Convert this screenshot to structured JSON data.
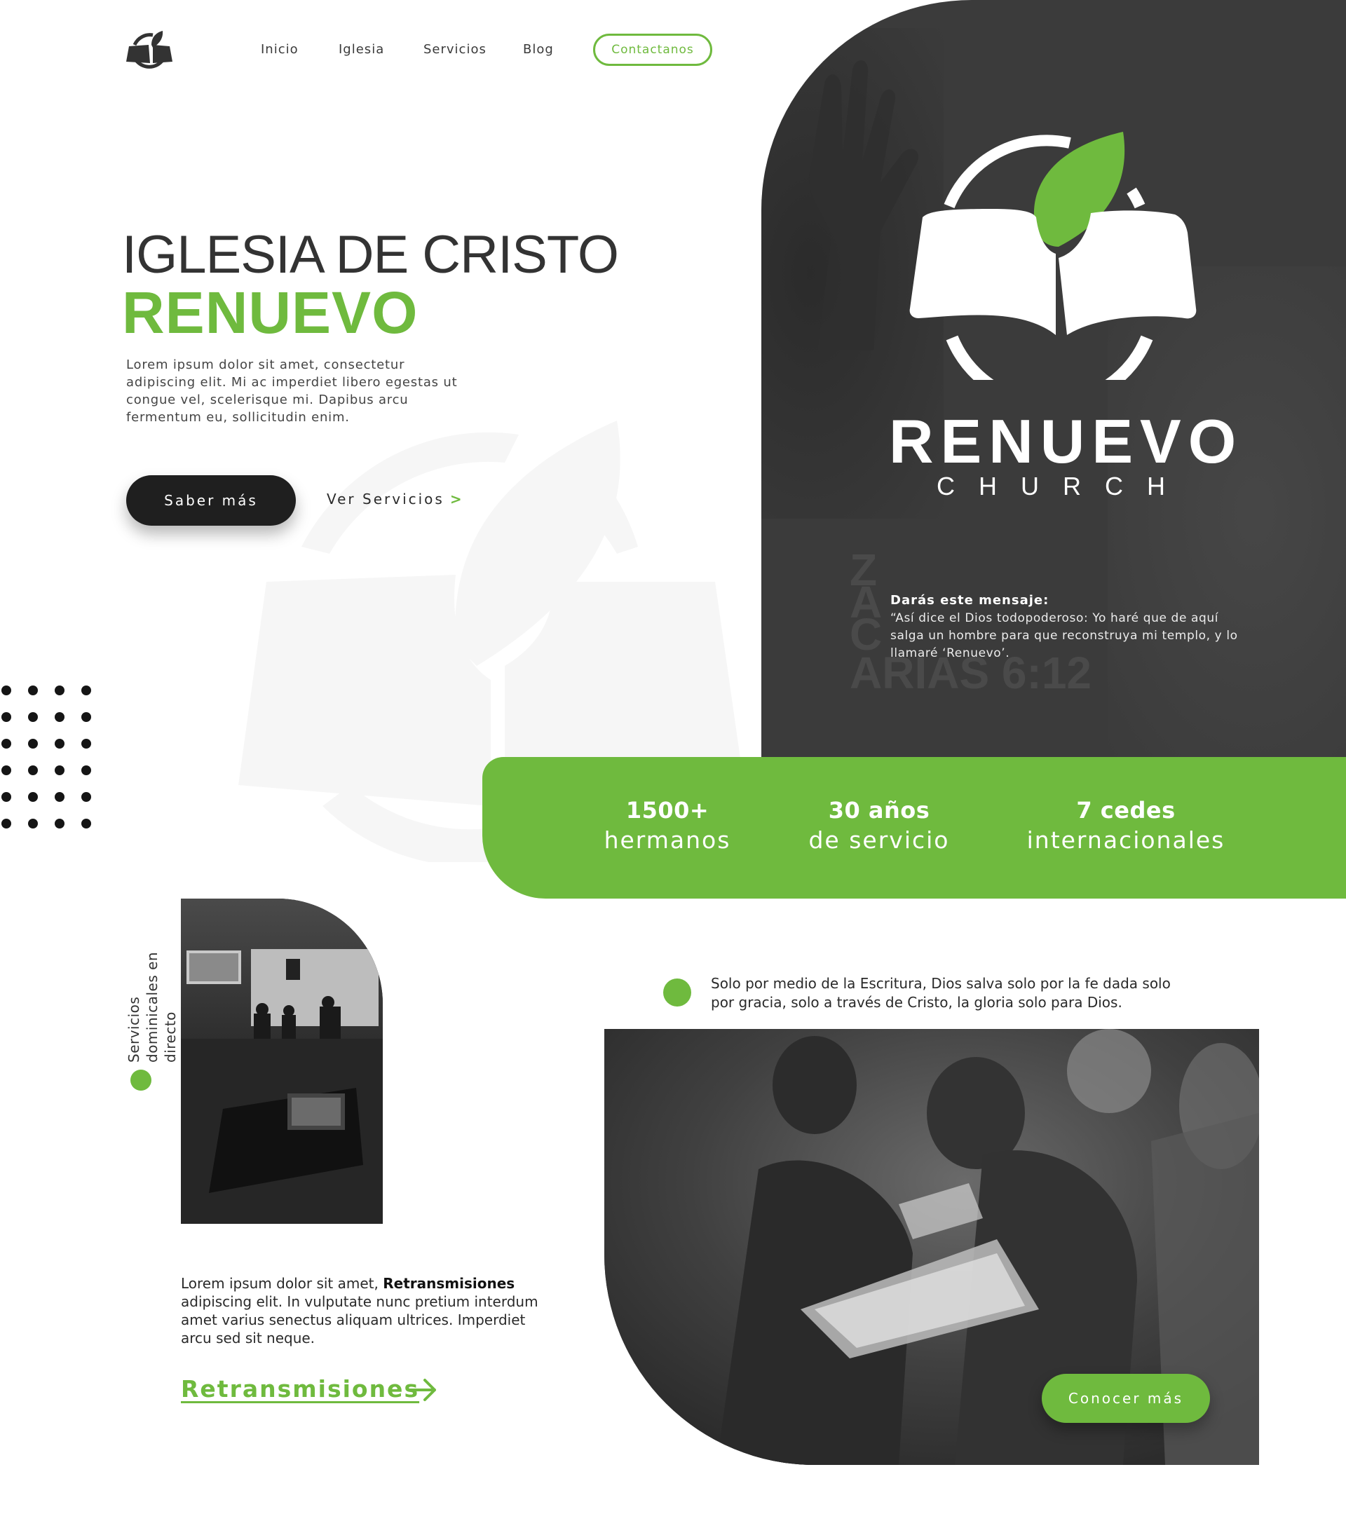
{
  "colors": {
    "accent": "#6fba3e",
    "dark": "#3b3b3b",
    "button_dark": "#1f1f1f"
  },
  "nav": {
    "logo_icon": "book-sprout-logo-icon",
    "links": [
      "Inicio",
      "Iglesia",
      "Servicios",
      "Blog"
    ],
    "contact_label": "Contactanos"
  },
  "hero": {
    "title": "IGLESIA DE CRISTO",
    "subtitle": "RENUEVO",
    "description": "Lorem ipsum dolor sit amet, consectetur adipiscing elit. Mi ac imperdiet libero egestas ut congue vel, scelerisque mi. Dapibus arcu fermentum eu, sollicitudin enim.",
    "primary_button": "Saber más",
    "secondary_link": "Ver Servicios",
    "secondary_chevron": ">"
  },
  "brand": {
    "name": "RENUEVO",
    "tagline": "CHURCH",
    "verse_ref_top": "ZAC",
    "verse_ref_bottom": "ARIAS 6:12",
    "verse_heading": "Darás este mensaje:",
    "verse_text": "“Así dice el Dios todopoderoso: Yo haré que de aquí salga un hombre para que reconstruya mi templo, y lo llamaré ‘Renuevo’."
  },
  "stats": [
    {
      "number": "1500+",
      "label": "hermanos"
    },
    {
      "number": "30 años",
      "label": "de servicio"
    },
    {
      "number": "7 cedes",
      "label": "internacionales"
    }
  ],
  "streams": {
    "vertical_label": "Servicios dominicales en directo",
    "description_lead": "Lorem ipsum dolor sit amet, ",
    "description_bold": "Retransmisiones",
    "description_rest": " adipiscing elit. In vulputate nunc pretium interdum amet varius senectus aliquam ultrices. Imperdiet arcu sed sit neque.",
    "link_label": "Retransmisiones"
  },
  "faith": {
    "quote": "Solo por medio de la Escritura, Dios salva solo por la fe dada solo por gracia, solo a través de Cristo, la gloria solo para Dios.",
    "button_label": "Conocer más"
  }
}
